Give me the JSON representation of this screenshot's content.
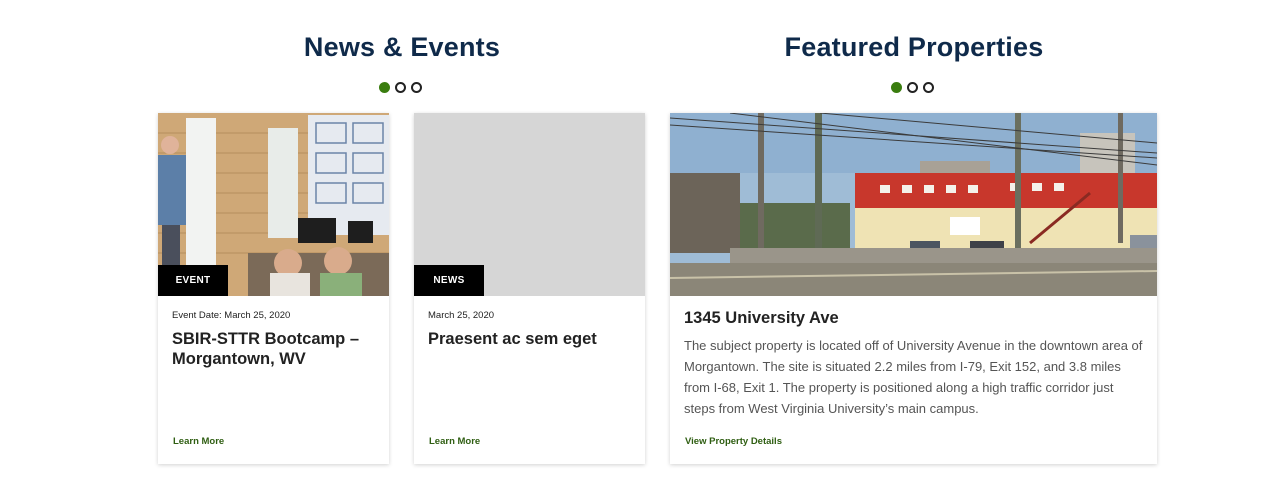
{
  "news": {
    "title": "News & Events",
    "cards": [
      {
        "badge": "EVENT",
        "meta": "Event Date: March 25, 2020",
        "headline": "SBIR-STTR Bootcamp – Morgantown, WV",
        "link": "Learn More"
      },
      {
        "badge": "NEWS",
        "meta": "March 25, 2020",
        "headline": "Praesent ac sem eget",
        "link": "Learn More"
      }
    ]
  },
  "properties": {
    "title": "Featured Properties",
    "card": {
      "name": "1345 University Ave",
      "description": "The subject property is located off of University Avenue in the downtown area of Morgantown. The site is situated 2.2 miles from I-79, Exit 152, and 3.8 miles from I-68, Exit 1. The property is positioned along a high traffic corridor just steps from West Virginia University’s main campus.",
      "link": "View Property Details"
    }
  },
  "carousel": {
    "active_color": "#3a7d0f"
  },
  "colors": {
    "title": "#0f2a4a",
    "link": "#2f5e12",
    "badge_bg": "#000000"
  }
}
